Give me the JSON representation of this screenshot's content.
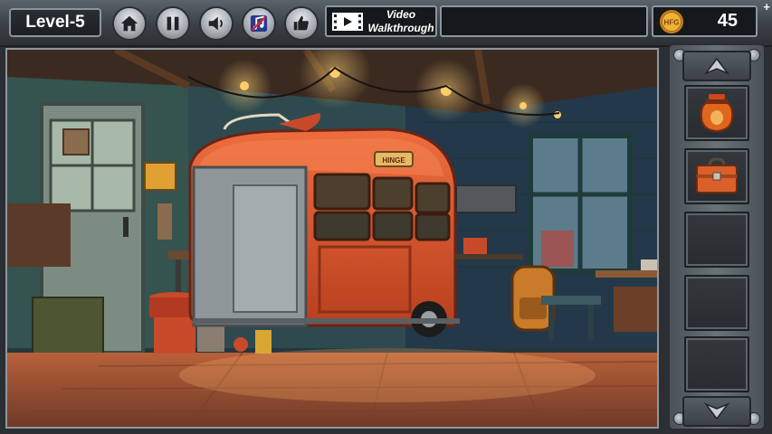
{
  "hud": {
    "level_label": "Level-5",
    "video_label_line1": "Video",
    "video_label_line2": "Walkthrough",
    "coin_label": "HFG",
    "coin_count": "45",
    "plus": "+"
  },
  "buttons": [
    "home-icon",
    "pause-icon",
    "sound-icon",
    "music-icon",
    "thumbs-up-icon"
  ],
  "scene": {
    "bus_plate": "HINGE"
  },
  "inventory": {
    "slots": [
      "jar-item",
      "toolbox-item",
      "",
      "",
      ""
    ]
  },
  "colors": {
    "bus_red": "#d6532d",
    "coin_gold": "#e8a21a",
    "panel_steel": "#5b636b"
  }
}
